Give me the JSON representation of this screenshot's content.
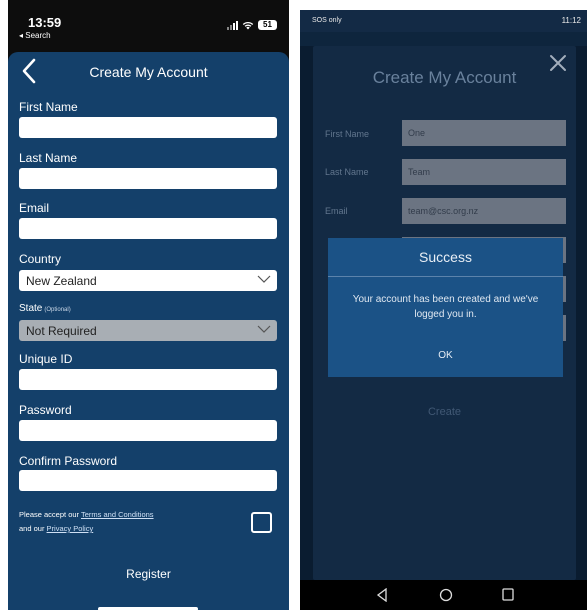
{
  "left_phone": {
    "status": {
      "time": "13:59",
      "back_label": "◂ Search",
      "battery": "51"
    },
    "title": "Create My Account",
    "fields": {
      "first_name": {
        "label": "First Name",
        "value": ""
      },
      "last_name": {
        "label": "Last Name",
        "value": ""
      },
      "email": {
        "label": "Email",
        "value": ""
      },
      "country": {
        "label": "Country",
        "value": "New Zealand"
      },
      "state": {
        "label": "State",
        "optional": "(Optional)",
        "value": "Not Required"
      },
      "unique_id": {
        "label": "Unique ID",
        "value": ""
      },
      "password": {
        "label": "Password",
        "value": ""
      },
      "confirm_password": {
        "label": "Confirm Password",
        "value": ""
      }
    },
    "terms": {
      "prefix": "Please accept our ",
      "terms_link": "Terms and Conditions",
      "middle": "and our ",
      "privacy_link": "Privacy Policy"
    },
    "register_label": "Register"
  },
  "right_phone": {
    "status": {
      "left": "SOS only",
      "right": "11:12"
    },
    "title": "Create My Account",
    "fields": [
      {
        "label": "First Name",
        "value": "One"
      },
      {
        "label": "Last Name",
        "value": "Team"
      },
      {
        "label": "Email",
        "value": "team@csc.org.nz"
      }
    ],
    "create_label": "Create",
    "dialog": {
      "title": "Success",
      "message": "Your account has been created and we've logged you in.",
      "ok_label": "OK"
    }
  },
  "colors": {
    "ios_sheet": "#14406a",
    "android_bg": "#16304e",
    "dialog": "#1b5286"
  }
}
